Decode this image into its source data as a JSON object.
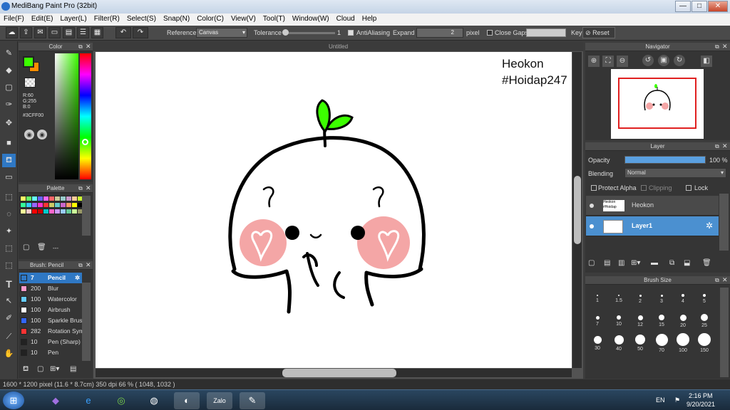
{
  "window": {
    "title": "MediBang Paint Pro (32bit)",
    "min": "—",
    "max": "□",
    "close": "✕"
  },
  "menu": [
    "File(F)",
    "Edit(E)",
    "Layer(L)",
    "Filter(R)",
    "Select(S)",
    "Snap(N)",
    "Color(C)",
    "View(V)",
    "Tool(T)",
    "Window(W)",
    "Cloud",
    "Help"
  ],
  "toolbar": {
    "reference_label": "Reference",
    "reference_value": "Canvas",
    "tolerance_label": "Tolerance",
    "tolerance_value": "1",
    "antialiasing_label": "AntiAliasing",
    "expand_label": "Expand",
    "expand_value": "2",
    "expand_unit": "pixel",
    "close_gaps_label": "Close Gaps",
    "key_label": "Key",
    "reset_label": "Reset"
  },
  "color_panel": {
    "title": "Color",
    "r": "R:60",
    "g": "G:255",
    "b": "B:0",
    "hex": "#3CFF00",
    "fg": "#3CFF00",
    "bg": "#ff8c00"
  },
  "palette": {
    "title": "Palette",
    "dash": "---",
    "colors": [
      "#ffff66",
      "#66ff66",
      "#66ffff",
      "#6666ff",
      "#ff66ff",
      "#ff6666",
      "#cccc99",
      "#99cccc",
      "#cc99cc",
      "#ffcc99",
      "#ccff33",
      "#33ff99",
      "#33ccff",
      "#9966ff",
      "#ff33cc",
      "#ff3333",
      "#cccc66",
      "#66cccc",
      "#cc66cc",
      "#ff9966",
      "#ffff00",
      "#000000",
      "#ffff99",
      "#ffcccc",
      "#ff0000",
      "#cc0000",
      "#00cccc",
      "#ff66cc",
      "#cc99ff",
      "#99ccff",
      "#66cc99",
      "#ccff99",
      "#999966"
    ]
  },
  "brush_panel": {
    "title": "Brush: Pencil",
    "items": [
      {
        "size": "7",
        "name": "Pencil",
        "color": "#2f78c4",
        "selected": true
      },
      {
        "size": "200",
        "name": "Blur",
        "color": "#ff99cc"
      },
      {
        "size": "100",
        "name": "Watercolor",
        "color": "#66ccff"
      },
      {
        "size": "100",
        "name": "Airbrush",
        "color": "#ffffff"
      },
      {
        "size": "100",
        "name": "Sparkle Brush",
        "color": "#3366ff"
      },
      {
        "size": "282",
        "name": "Rotation Sym",
        "color": "#ff3333"
      },
      {
        "size": "10",
        "name": "Pen (Sharp)",
        "color": "#222222"
      },
      {
        "size": "10",
        "name": "Pen",
        "color": "#222222"
      }
    ]
  },
  "document": {
    "tab": "Untitled",
    "watermark_line1": "Heokon",
    "watermark_line2": "#Hoidap247"
  },
  "status": "1600 * 1200 pixel   (11.6 * 8.7cm)   350 dpi   66 %   ( 1048, 1032 )",
  "navigator": {
    "title": "Navigator"
  },
  "layer_panel": {
    "title": "Layer",
    "opacity_label": "Opacity",
    "opacity_value": "100 %",
    "opacity": 1.0,
    "blending_label": "Blending",
    "blending_value": "Normal",
    "protect_alpha": "Protect Alpha",
    "clipping": "Clipping",
    "lock": "Lock",
    "layers": [
      {
        "name": "Heokon",
        "selected": false
      },
      {
        "name": "Layer1",
        "selected": true
      }
    ]
  },
  "brush_size": {
    "title": "Brush Size",
    "row1": [
      "1",
      "1.5",
      "2",
      "3",
      "4",
      "5"
    ],
    "row2": [
      "7",
      "10",
      "12",
      "15",
      "20",
      "25"
    ],
    "row3": [
      "30",
      "40",
      "50",
      "70",
      "100",
      "150"
    ]
  },
  "tray": {
    "lang": "EN",
    "time": "2:16 PM",
    "date": "9/20/2021"
  }
}
